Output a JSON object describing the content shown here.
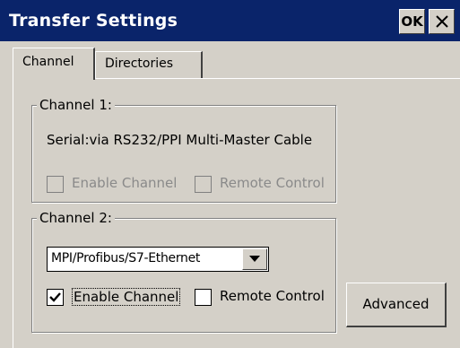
{
  "window": {
    "title": "Transfer Settings"
  },
  "titlebar": {
    "ok_label": "OK",
    "close_icon": "close-icon"
  },
  "tabs": [
    {
      "label": "Channel",
      "active": true
    },
    {
      "label": "Directories",
      "active": false
    }
  ],
  "channel1": {
    "legend": "Channel 1:",
    "description": "Serial:via RS232/PPI Multi-Master Cable",
    "enable_label": "Enable Channel",
    "enable_checked": false,
    "enable_disabled": true,
    "remote_label": "Remote Control",
    "remote_checked": false,
    "remote_disabled": true
  },
  "channel2": {
    "legend": "Channel 2:",
    "protocol_value": "MPI/Profibus/S7-Ethernet",
    "enable_label": "Enable Channel",
    "enable_checked": true,
    "remote_label": "Remote Control",
    "remote_checked": false
  },
  "advanced_label": "Advanced"
}
